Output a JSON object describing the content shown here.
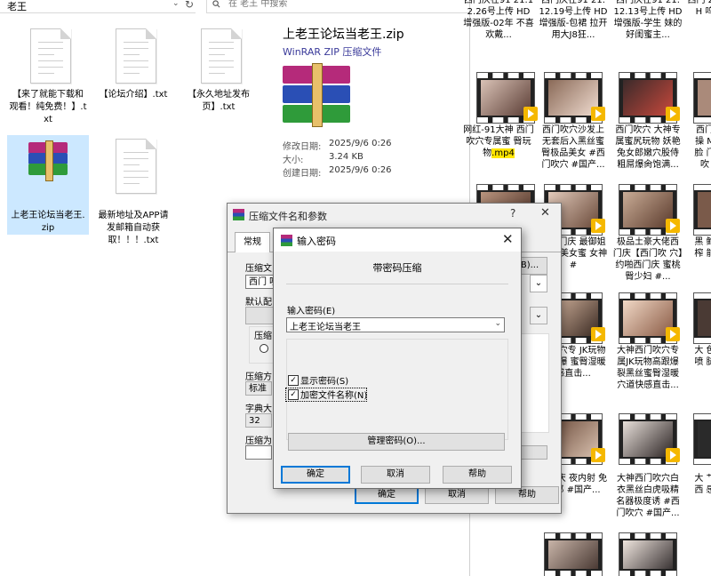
{
  "explorer": {
    "address": "老王",
    "search_placeholder": "在 老王 中搜索",
    "files": [
      {
        "name": "【来了就能下载和观看！纯免费！】.txt"
      },
      {
        "name": "【论坛介绍】.txt"
      },
      {
        "name": "【永久地址发布页】.txt"
      },
      {
        "name": "上老王论坛当老王.zip"
      },
      {
        "name": "最新地址及APP请发邮箱自动获取！！！.txt"
      }
    ],
    "preview": {
      "title": "上老王论坛当老王.zip",
      "type": "WinRAR ZIP 压缩文件",
      "modified_label": "修改日期:",
      "modified_value": "2025/9/6 0:26",
      "size_label": "大小:",
      "size_value": "3.24 KB",
      "created_label": "创建日期:",
      "created_value": "2025/9/6 0:26"
    }
  },
  "video_pane": {
    "captions_top": [
      "西门庆在91 21.12.26号上传 HD增强版-02年 不喜欢戴...",
      "西门庆在91 21. 12.19号上传 HD增强版-包裙 拉开用大J8狂...",
      "西门庆在91 21. 12.13号上传 HD增强版-学生 妹的好闺蜜主...",
      "西门 21. H 呜"
    ],
    "captions_row2": [
      "网红-91大神 西门吹穴专属蜜 臀玩物.mp4",
      "西门吹穴沙发上 无套后入黑丝蜜 臀极品美女 #西 门吹穴 #国产...",
      "西门吹穴 大神专 属蜜尻玩物 妖艳 兔女郎嫩穴股侍 粗屌爆肏饱满...",
      "西门 操 M脸 门吹"
    ],
    "captions_row3": [
      "神西门庆 最御姐范 感美女蜜 女神 #",
      "极品土豪大佬西 门庆【西门吹 穴】约啪西门庆 蜜桃臀少妇 #...",
      "黑 鲍 榨 能"
    ],
    "captions_row4": [
      "门吹穴专 JK玩物高跟爆 蜜臀湿暖 感直击...",
      "大神西门吹穴专 属JK玩物高跟爆 裂黑丝蜜臀湿暖 穴道快感直击...",
      "大 色 喷 腿"
    ],
    "captions_row5": [
      "西门庆 夜内射 免女郎 #国产...",
      "大神西门吹穴白 衣黑丝白虎吸精 名器极度诱 #西 门吹穴 #国产...",
      "大 艹 西 感"
    ],
    "mp4_highlight": ".mp4"
  },
  "back_dialog": {
    "title": "压缩文件名和参数",
    "help_glyph": "?",
    "close_glyph": "✕",
    "tab_general": "常规",
    "label_archive": "压缩文",
    "archive_value": "西门 吹",
    "label_default": "默认配",
    "label_format": "压缩",
    "label_method": "压缩方",
    "method_value": "标准",
    "label_dict": "字典大",
    "dict_value": "32",
    "label_split": "压缩为",
    "browse_label": "B)...",
    "ok": "确定",
    "cancel": "取消",
    "help": "帮助"
  },
  "password_dialog": {
    "title": "输入密码",
    "close_glyph": "✕",
    "heading": "带密码压缩",
    "password_label": "输入密码(E)",
    "password_value": "上老王论坛当老王",
    "show_password_label": "显示密码(S)",
    "show_password_checked": true,
    "encrypt_names_label": "加密文件名称(N)",
    "encrypt_names_checked": true,
    "manage_label": "管理密码(O)...",
    "ok": "确定",
    "cancel": "取消",
    "help": "帮助"
  },
  "colors": {
    "selection": "#cce8ff",
    "dialog_bg": "#f0f0f0",
    "primary_border": "#0078d7",
    "badge": "#f5b800"
  }
}
